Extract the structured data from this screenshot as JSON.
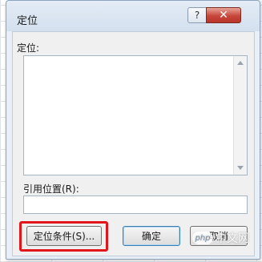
{
  "dialog": {
    "title": "定位",
    "help_glyph": "?",
    "close_glyph": "✕",
    "goto_label": "定位:",
    "reference_label": "引用位置(R):",
    "reference_value": "",
    "buttons": {
      "special": "定位条件(S)...",
      "ok": "确定",
      "cancel": "取消"
    }
  },
  "watermark": {
    "logo_text": "php",
    "text": "中文网"
  },
  "colors": {
    "highlight": "#e0161b",
    "close_button": "#c7463a"
  }
}
